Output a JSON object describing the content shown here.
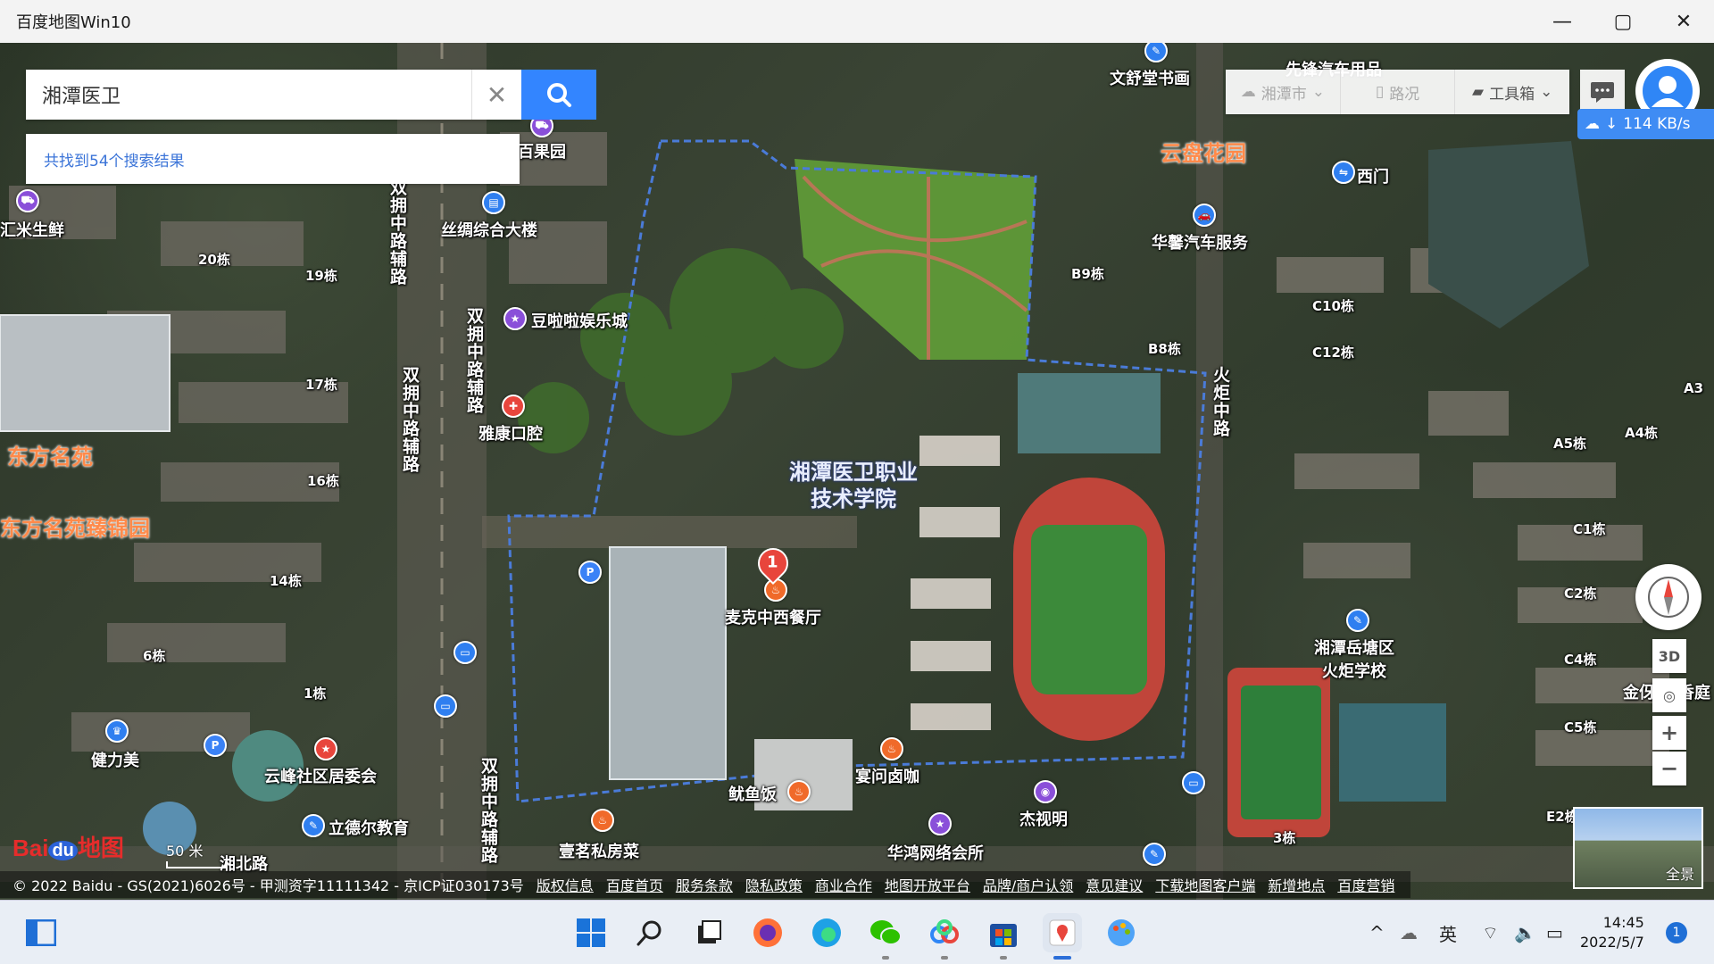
{
  "window": {
    "title": "百度地图Win10",
    "minimize": "—",
    "restore": "▢",
    "close": "✕"
  },
  "search": {
    "query": "湘潭医卫",
    "result_count_text": "共找到54个搜索结果"
  },
  "toolbar": {
    "city": "湘潭市",
    "traffic": "路况",
    "toolbox": "工具箱"
  },
  "speed": "114 KB/s",
  "map_labels": {
    "wenshutang": "文舒堂书画",
    "yunpan": "云盘花园",
    "ximen": "西门",
    "huaxin": "华馨汽车服务",
    "b9": "B9栋",
    "c10": "C10栋",
    "b8": "B8栋",
    "c12": "C12栋",
    "a3": "A3",
    "a4": "A4栋",
    "a5": "A5栋",
    "c1": "C1栋",
    "c2": "C2栋",
    "c4": "C4栋",
    "c5": "C5栋",
    "e2": "E2栋",
    "building3": "3栋",
    "jinyi": "金伢",
    "xiangting": "香庭",
    "baiguoyuan": "百果园",
    "sichou": "丝绸综合大楼",
    "huimi": "汇米生鲜",
    "b20": "20栋",
    "b19": "19栋",
    "b17": "17栋",
    "b16": "16栋",
    "b14": "14栋",
    "b6": "6栋",
    "b1": "1栋",
    "doulala": "豆啦啦娱乐城",
    "yakang": "雅康口腔",
    "dongfang": "东方名苑",
    "dongfang_jinyuan": "东方名苑臻锦园",
    "campus_line1": "湘潭医卫职业",
    "campus_line2": "技术学院",
    "maike": "麦克中西餐厅",
    "youyufan": "鱿鱼饭",
    "yanwen": "宴问卤咖",
    "jieshiming": "杰视明",
    "huahong": "华鸿网络会所",
    "yiming": "壹茗私房菜",
    "yunfeng": "云峰社区居委会",
    "lideer": "立德尔教育",
    "jianlimei": "健力美",
    "school_line1": "湘潭岳塘区",
    "school_line2": "火炬学校",
    "xiangbei": "湘北路",
    "road_shuangyong1": "双拥中路辅路",
    "road_shuangyong2": "双拥中路辅路",
    "road_shuangyong3": "双拥中路辅路",
    "road_shuangyong4": "双拥中路辅路",
    "road_huoju": "火炬中路",
    "xianqiche": "先锋汽车用品"
  },
  "marker_number": "1",
  "scale_label": "50 米",
  "logo": {
    "bai": "Bai",
    "du": "du",
    "ditu": "地图"
  },
  "controls": {
    "three_d": "3D",
    "zoom_in": "+",
    "zoom_out": "−",
    "pano_label": "全景"
  },
  "copyright": {
    "text": "© 2022 Baidu - GS(2021)6026号 - 甲测资字11111342 - 京ICP证030173号",
    "links": [
      "版权信息",
      "百度首页",
      "服务条款",
      "隐私政策",
      "商业合作",
      "地图开放平台",
      "品牌/商户认领",
      "意见建议",
      "下载地图客户端",
      "新增地点",
      "百度营销"
    ]
  },
  "taskbar": {
    "ime": "英",
    "time": "14:45",
    "date": "2022/5/7",
    "notifications": "1"
  },
  "colors": {
    "accent": "#3385ff",
    "campus_boundary": "#4a7bd8",
    "track": "#c0453a",
    "field": "#3c8a3a"
  }
}
